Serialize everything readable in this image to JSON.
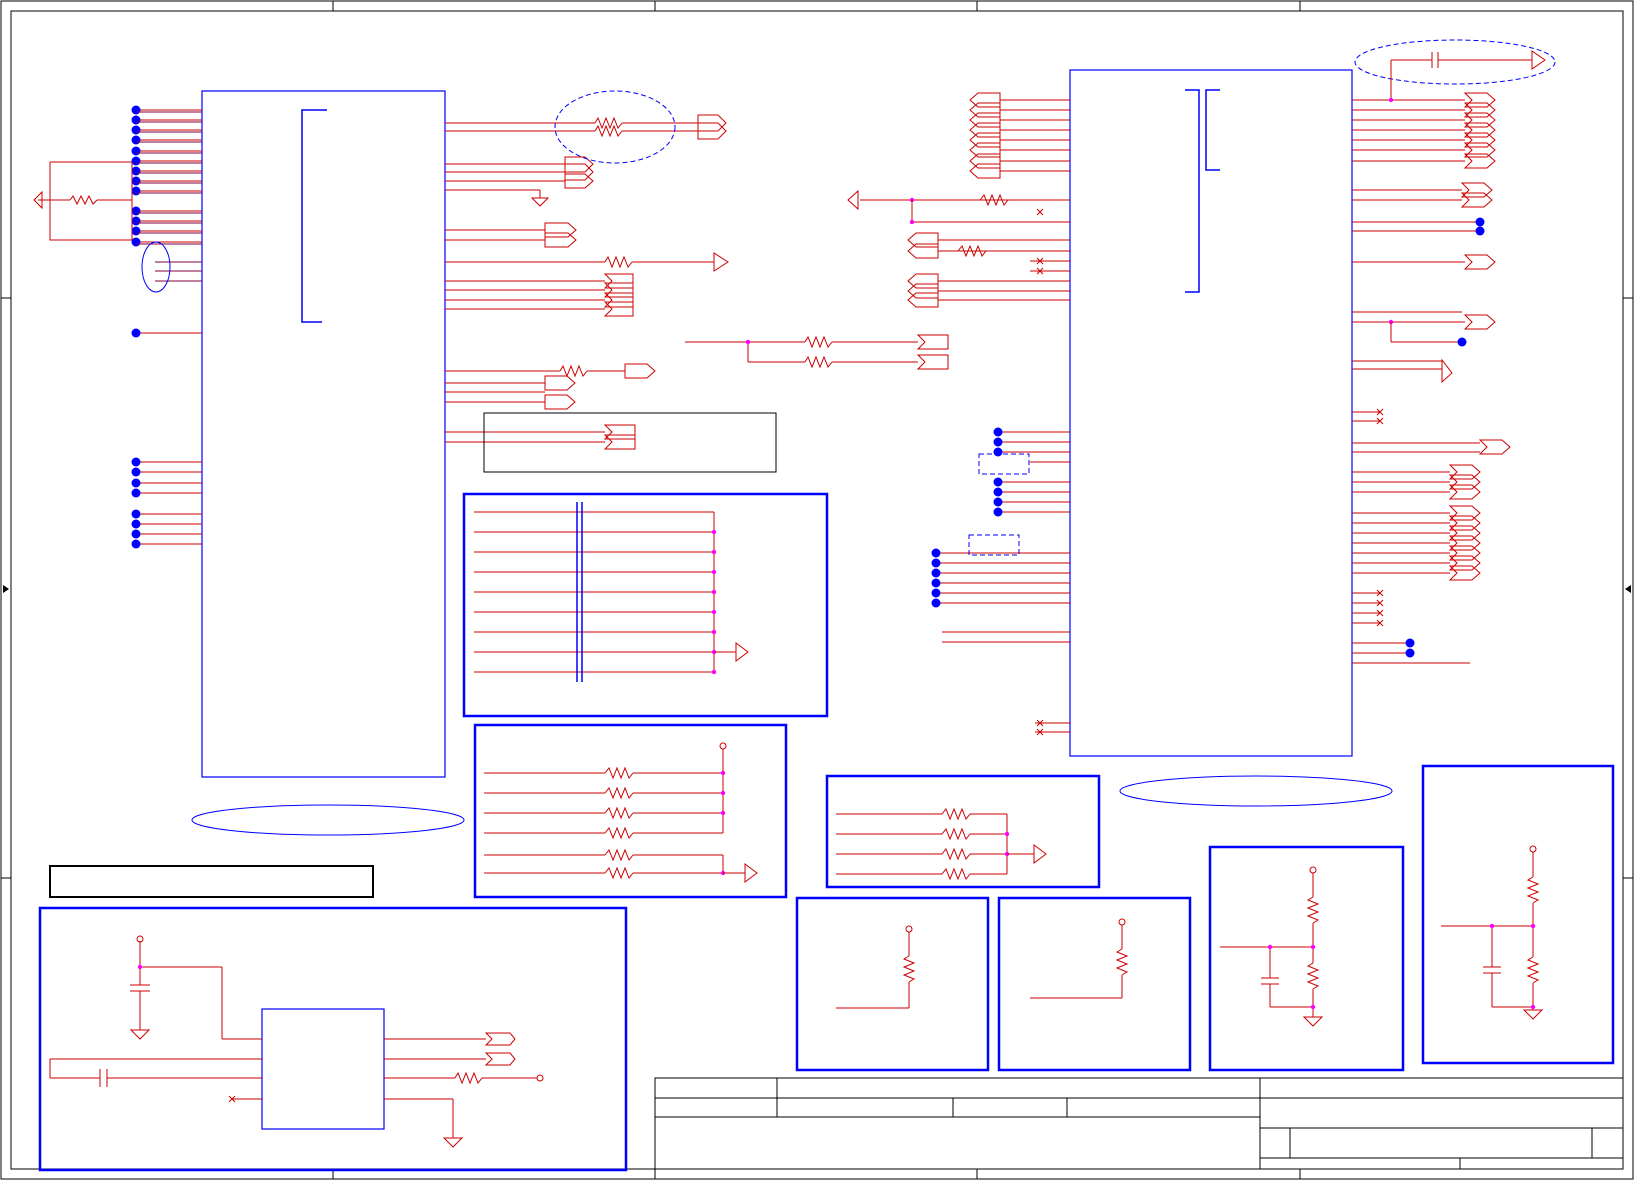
{
  "sheet": {
    "title": "",
    "colors": {
      "frame": "#000000",
      "component": "#0000ff",
      "wire": "#cc0000",
      "bus": "#800040",
      "junction": "#ff00ff",
      "no_connect": "#cc0000",
      "annotation": "#0000ff"
    }
  },
  "components": {
    "main_ic_left": {
      "kind": "ic-body"
    },
    "main_ic_right": {
      "kind": "ic-body"
    },
    "sub_ic_bottom": {
      "kind": "ic-body"
    }
  },
  "title_block": {
    "rows": 5
  }
}
